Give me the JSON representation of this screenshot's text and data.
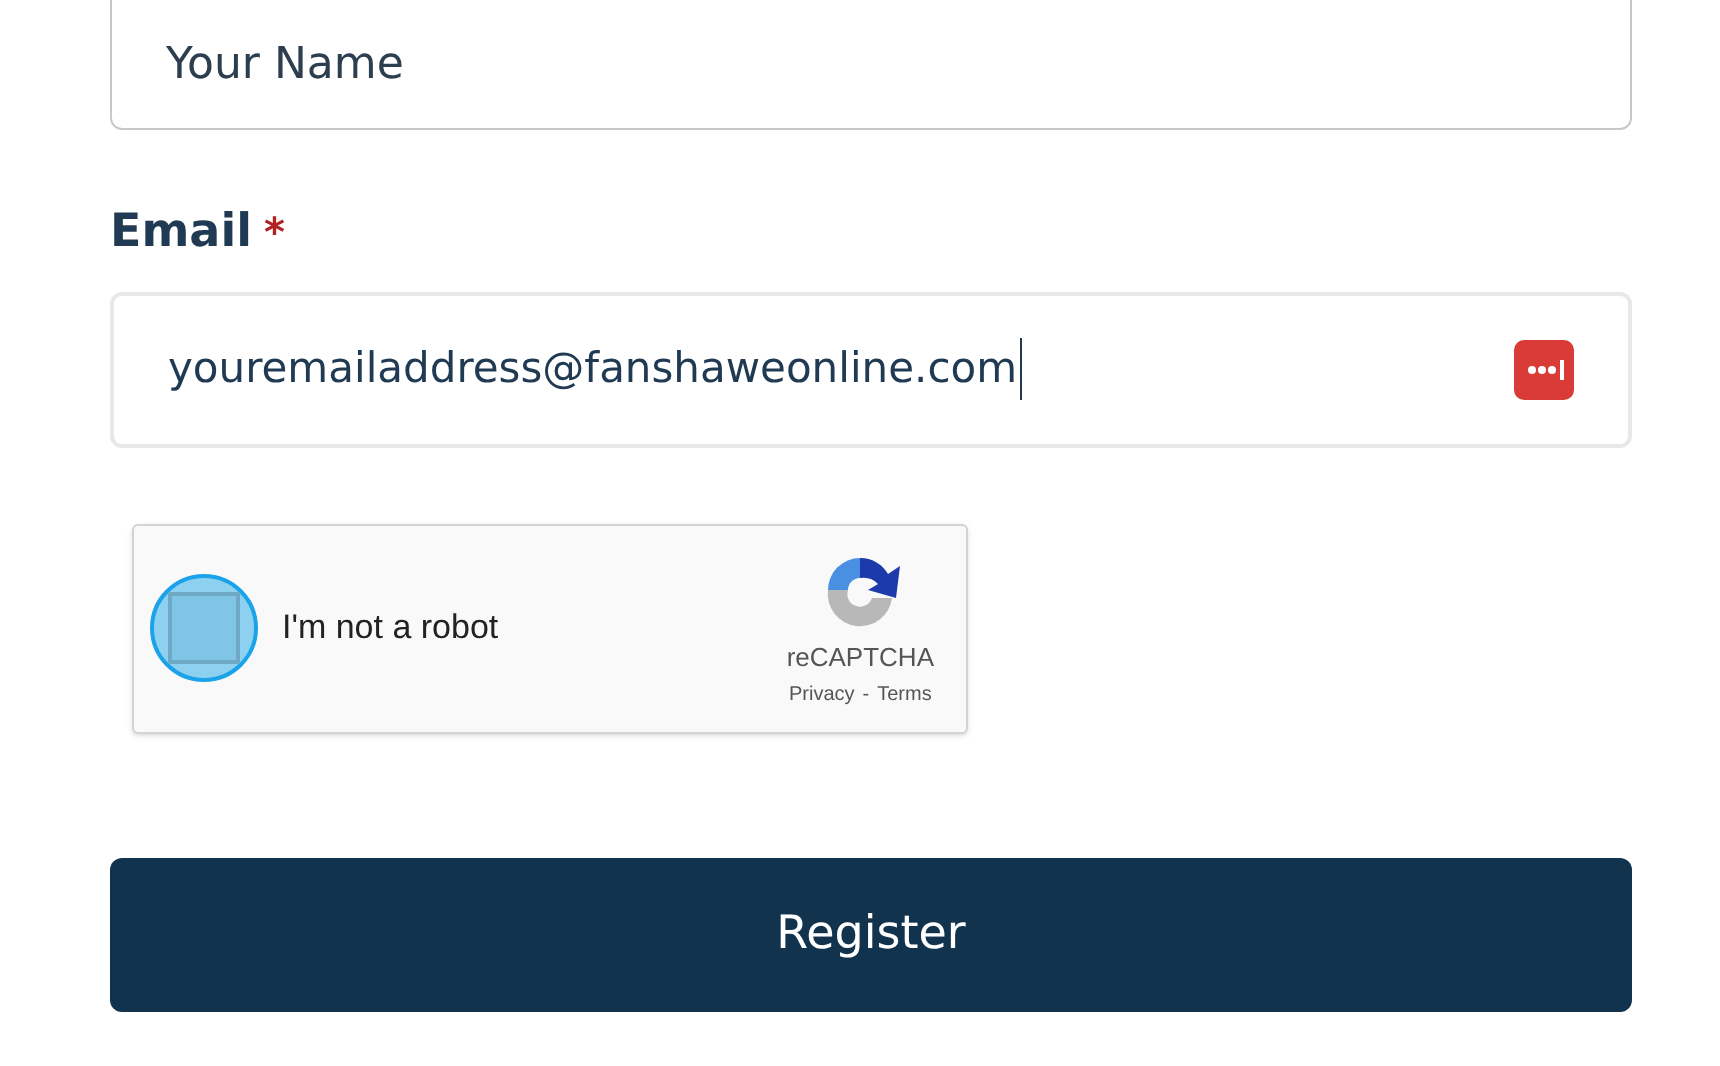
{
  "name_field": {
    "placeholder": "Your Name"
  },
  "email": {
    "label": "Email",
    "required_mark": "*",
    "value": "youremailaddress@fanshaweonline.com"
  },
  "captcha": {
    "label": "I'm not a robot",
    "checked": false,
    "brand": "reCAPTCHA",
    "privacy": "Privacy",
    "separator": "-",
    "terms": "Terms"
  },
  "submit": {
    "label": "Register"
  }
}
